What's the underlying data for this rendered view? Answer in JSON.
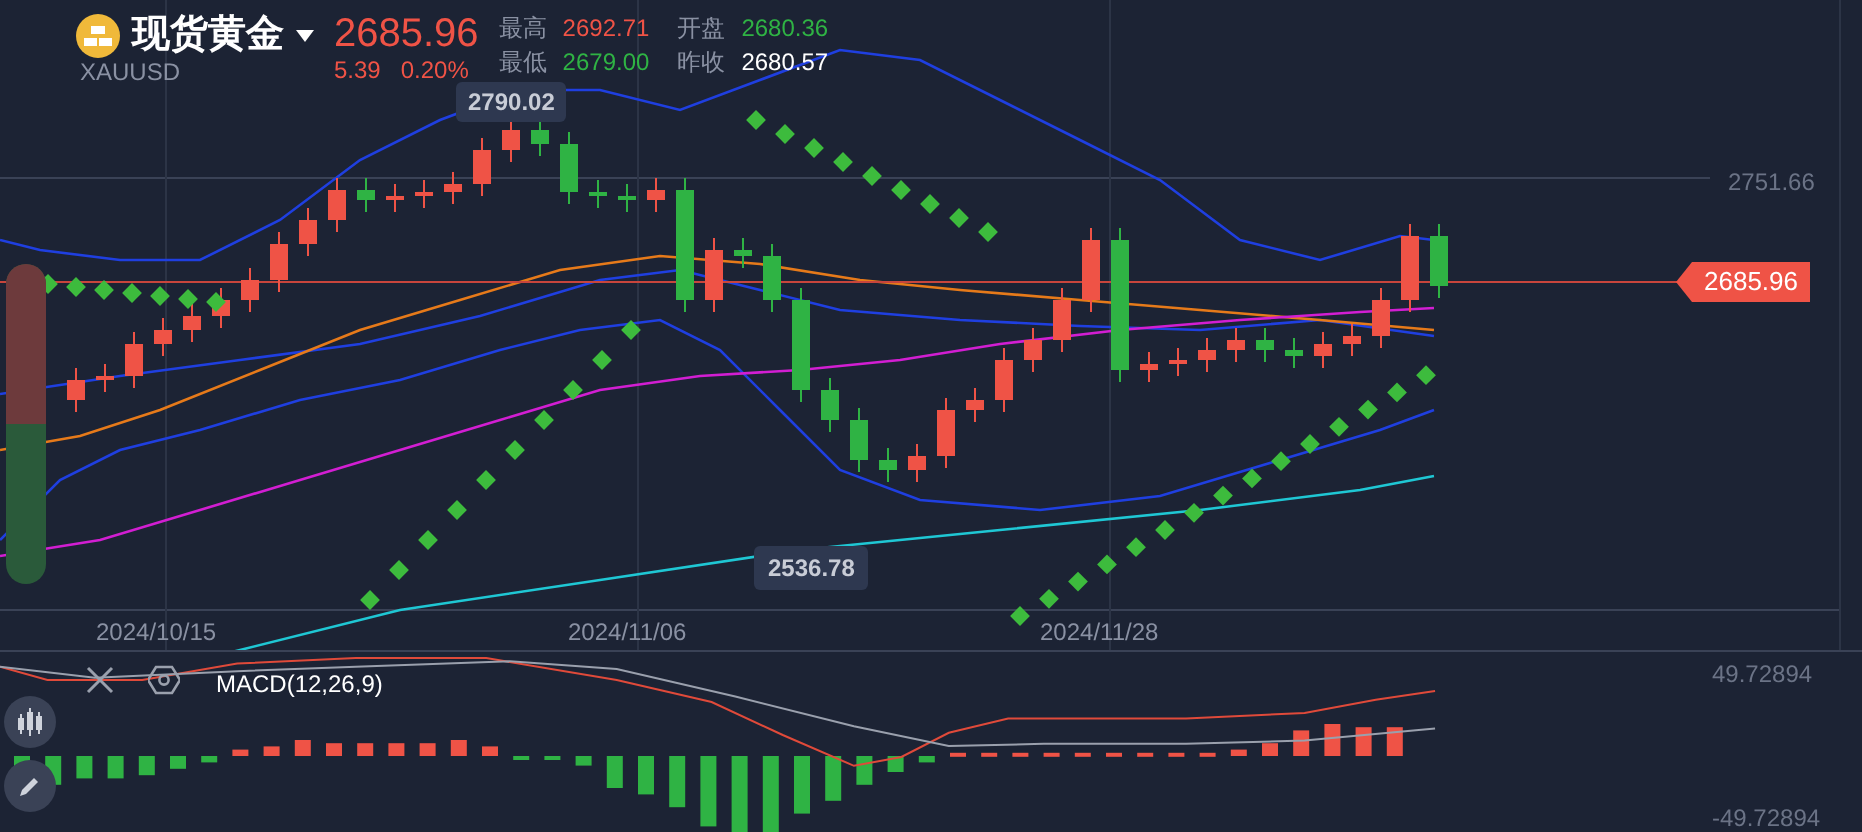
{
  "header": {
    "title": "现货黄金",
    "symbol": "XAUUSD",
    "price": "2685.96",
    "change": "5.39",
    "change_percent": "0.20%",
    "stats": [
      {
        "label": "最高",
        "value": "2692.71",
        "color": "#ef5346"
      },
      {
        "label": "开盘",
        "value": "2680.36",
        "color": "#2fb344"
      },
      {
        "label": "最低",
        "value": "2679.00",
        "color": "#2fb344"
      },
      {
        "label": "昨收",
        "value": "2680.57",
        "color": "#ffffff"
      }
    ]
  },
  "chart": {
    "price_ticks": [
      "2751.66"
    ],
    "current_price": "2685.96",
    "high_marker": "2790.02",
    "low_marker": "2536.78",
    "dates": [
      "2024/10/15",
      "2024/11/06",
      "2024/11/28"
    ]
  },
  "macd": {
    "title": "MACD(12,26,9)",
    "ticks": [
      "49.72894",
      "-49.72894"
    ]
  }
}
